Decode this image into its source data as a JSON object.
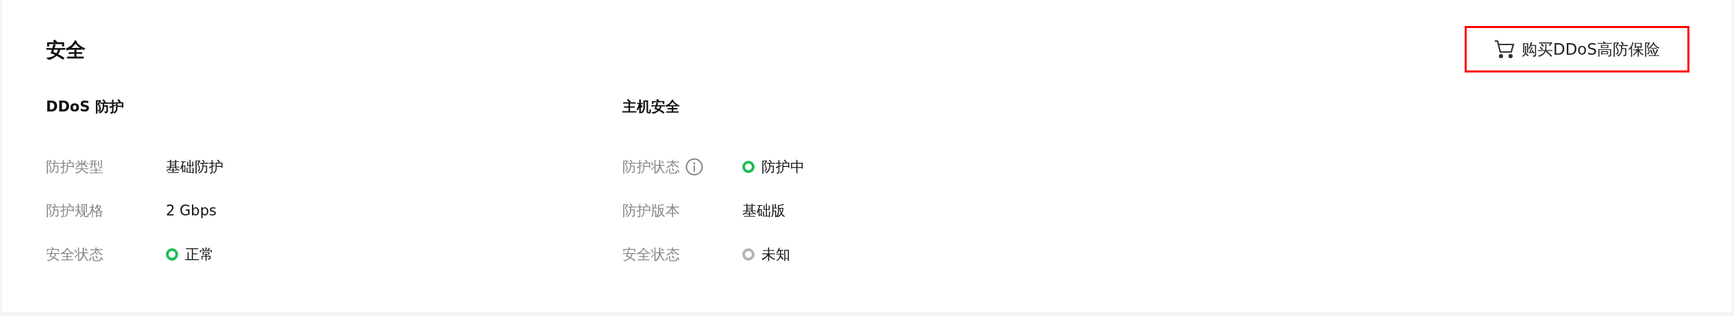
{
  "title": "安全",
  "action": {
    "label": "购买DDoS高防保险"
  },
  "sections": [
    {
      "title": "DDoS 防护",
      "fields": [
        {
          "label": "防护类型",
          "value": "基础防护",
          "kind": "text"
        },
        {
          "label": "防护规格",
          "value": "2 Gbps",
          "kind": "text"
        },
        {
          "label": "安全状态",
          "value": "正常",
          "kind": "status",
          "color": "#1fbd56"
        }
      ]
    },
    {
      "title": "主机安全",
      "fields": [
        {
          "label": "防护状态",
          "value": "防护中",
          "kind": "status",
          "color": "#1fbd56",
          "info": true
        },
        {
          "label": "防护版本",
          "value": "基础版",
          "kind": "text"
        },
        {
          "label": "安全状态",
          "value": "未知",
          "kind": "status",
          "color": "#b3b3b3"
        }
      ]
    }
  ]
}
